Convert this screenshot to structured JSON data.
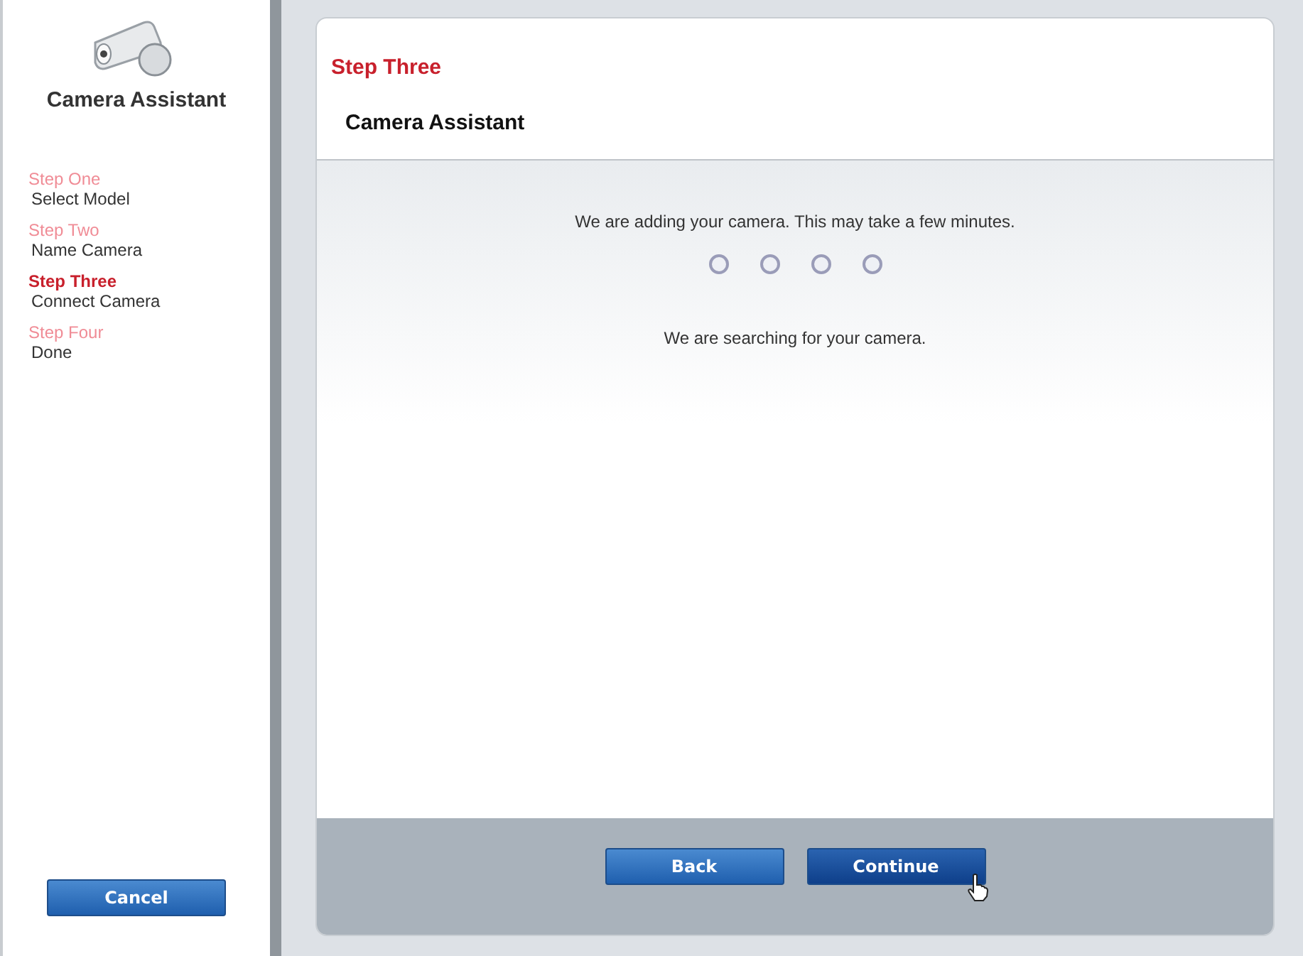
{
  "sidebar": {
    "title": "Camera Assistant",
    "steps": [
      {
        "label": "Step One",
        "name": "Select Model",
        "selected": false
      },
      {
        "label": "Step Two",
        "name": "Name Camera",
        "selected": false
      },
      {
        "label": "Step Three",
        "name": "Connect Camera",
        "selected": true
      },
      {
        "label": "Step Four",
        "name": "Done",
        "selected": false
      }
    ],
    "cancel_button": "Cancel"
  },
  "panel": {
    "step_label": "Step Three",
    "title": "Camera Assistant",
    "message": "We are adding your camera. This may take a few minutes.",
    "status": "We are searching for your camera.",
    "buttons": [
      {
        "label": "Back",
        "kind": "secondary"
      },
      {
        "label": "Continue",
        "kind": "primary"
      }
    ]
  }
}
